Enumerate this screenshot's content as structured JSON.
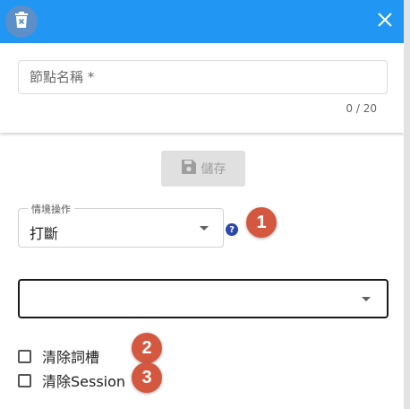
{
  "colors": {
    "header": "#2196f3",
    "badge": "#d4573f",
    "help": "#2b47a8"
  },
  "header": {
    "delete_icon": "trash-icon",
    "close_icon": "close-icon"
  },
  "form": {
    "name_placeholder": "節點名稱 *",
    "name_value": "",
    "counter": "0 / 20",
    "save_label": "儲存",
    "save_icon": "save-icon"
  },
  "scenario": {
    "label": "情境操作",
    "value": "打斷",
    "help_glyph": "?"
  },
  "secondary_select": {
    "value": ""
  },
  "checkboxes": [
    {
      "label": "清除詞槽",
      "checked": false
    },
    {
      "label": "清除Session",
      "checked": false
    }
  ],
  "badges": [
    "1",
    "2",
    "3"
  ]
}
